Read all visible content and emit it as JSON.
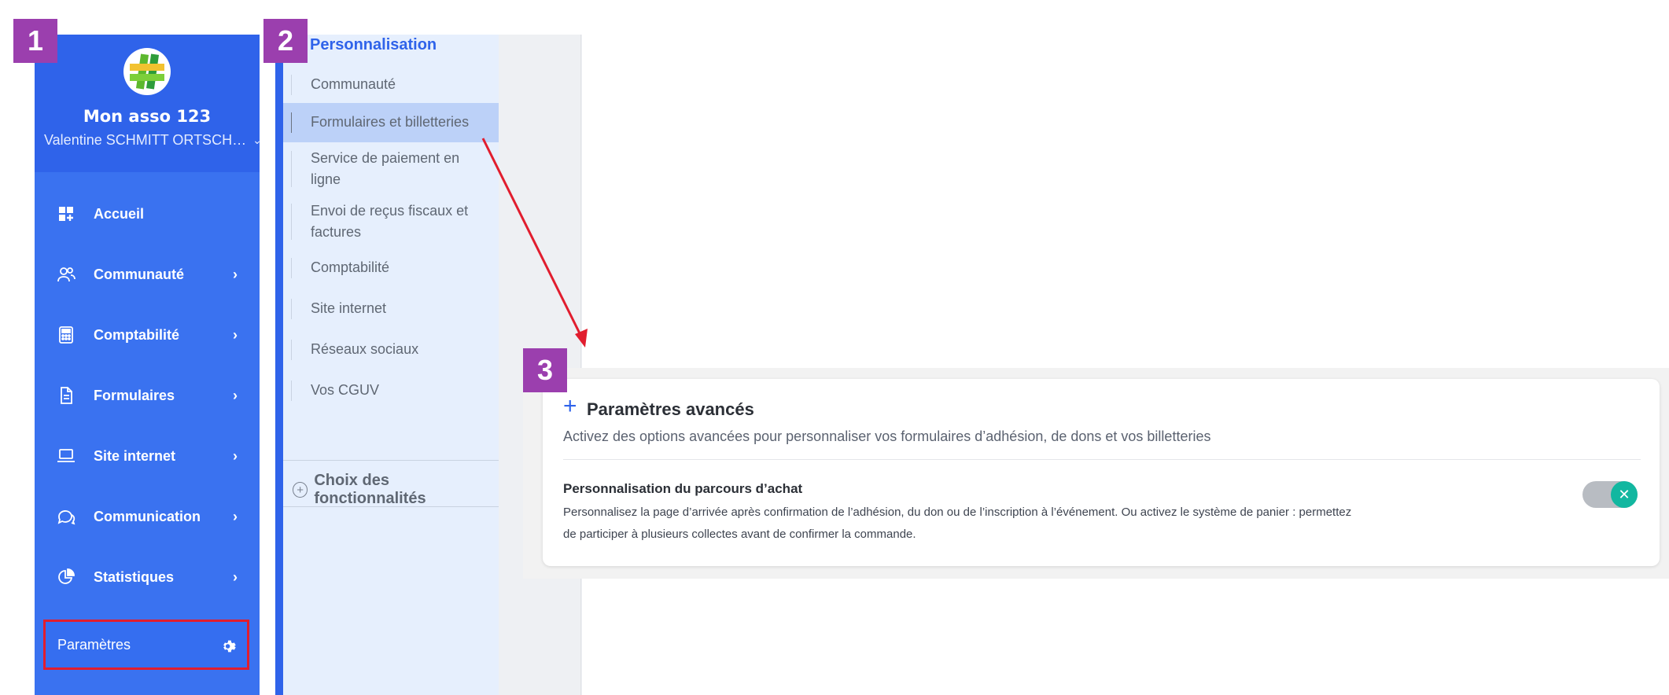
{
  "badges": [
    "1",
    "2",
    "3"
  ],
  "nav": {
    "org_name": "Mon asso 123",
    "user": "Valentine SCHMITT ORTSCH…",
    "items": [
      {
        "label": "Accueil",
        "icon": "dashboard-icon",
        "has_arrow": false
      },
      {
        "label": "Communauté",
        "icon": "users-icon",
        "has_arrow": true
      },
      {
        "label": "Comptabilité",
        "icon": "calculator-icon",
        "has_arrow": true
      },
      {
        "label": "Formulaires",
        "icon": "document-icon",
        "has_arrow": true
      },
      {
        "label": "Site internet",
        "icon": "laptop-icon",
        "has_arrow": true
      },
      {
        "label": "Communication",
        "icon": "chat-icon",
        "has_arrow": true
      },
      {
        "label": "Statistiques",
        "icon": "pie-chart-icon",
        "has_arrow": true
      }
    ],
    "arrow": "›",
    "chevron": "⌄",
    "params_label": "Paramètres"
  },
  "submenu": {
    "title": "Personnalisation",
    "items": [
      {
        "label": "Communauté",
        "active": false
      },
      {
        "label": "Formulaires et billetteries",
        "active": true
      },
      {
        "label": "Service de paiement en ligne",
        "active": false
      },
      {
        "label": "Envoi de reçus fiscaux et factures",
        "active": false
      },
      {
        "label": "Comptabilité",
        "active": false
      },
      {
        "label": "Site internet",
        "active": false
      },
      {
        "label": "Réseaux sociaux",
        "active": false
      },
      {
        "label": "Vos CGUV",
        "active": false
      }
    ],
    "features_label": "Choix des fonctionnalités"
  },
  "card": {
    "title": "Paramètres avancés",
    "subtitle": "Activez des options avancées pour personnaliser vos formulaires d’adhésion, de dons et vos billetteries",
    "option_title": "Personnalisation du parcours d’achat",
    "option_desc": "Personnalisez la page d’arrivée après confirmation de l’adhésion, du don ou de l’inscription à l’événement. Ou activez le système de panier : permettez de participer à plusieurs collectes avant de confirmer la commande.",
    "toggle_on": true
  },
  "colors": {
    "nav": "#3a72f0",
    "nav_header": "#2f63ea",
    "submenu": "#e6effd",
    "submenu_active": "#bcd1f8",
    "badge": "#9b3fae",
    "highlight": "#e11d2e",
    "toggle_knob": "#12b7a0"
  }
}
